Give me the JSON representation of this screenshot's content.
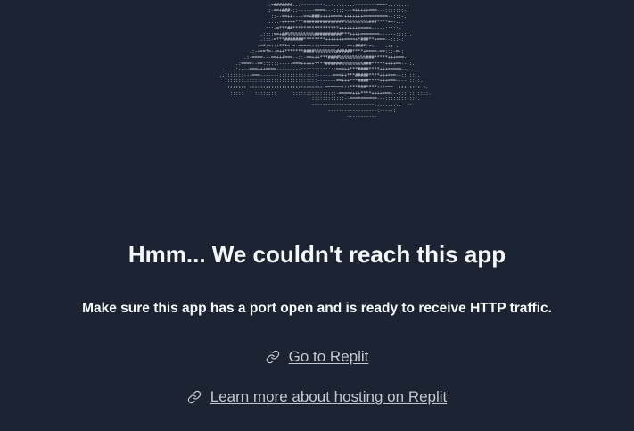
{
  "ascii_art": "                          -+##***#====--::==--::. ..   --         ::\n                        .=#######:::---------::-::::::::--------===-:.:::::.\n                        :-==+###-::------====---::::---=+++++===---:::::::-.\n                         ::--==++----==+###++++====-+++++++=========--:::-.\n                        ::::-+++++***###############%%%%%%%%%###****+=-::.\n                      .:::-=***##*****************+++++++=====-----:::::-.\n                     .::::==+##%%%%%%%%%%##########***++++=======------:::::.\n                     .:::-=***#######********+++++++====+*###**+===--:::-:\n                    :=*+=+++***=-=-====++++=======---==+###*+=:    .::-.\n                 .:-+==*=--=++*******####%%%%%%%%######****+====-==:::-=-:\n               .:-====---==+++===--::-==+++***####%%%%%%%%%%###*****+++===-.\n            .:====--==::::::-----===+++++****######%%%%%%%%###*****++++==--::.\n        .  .:----===+++====---------:::::::::::::===++***####****+++=====---.\n      ..:::::::---===-------::::::::::::::------===++***#####****+++===--::::::.\n        :::::::.::::::::::::::::::::::::::-------==+++***####****+++===----:::::.\n         :::::::-:::::::::::::::::::::::::::-======+++***###****+++===--::::::::-:.\n          :::::    ::::::::      ::::::::::::::::-=====+++****++++===---:::::::::::.\n                                        ::::::::::::--==========---::::::::::::.\n                                        -----------------------::::::::::  --\n                                              ------------------:-----:\n                                                     -----------",
  "headline": "Hmm... We couldn't reach this app",
  "subtext": "Make sure this app has a port open and is ready to receive HTTP traffic.",
  "links": {
    "go_to_replit": "Go to Replit",
    "learn_more": "Learn more about hosting on Replit"
  },
  "icons": {
    "link": "link-icon"
  },
  "colors": {
    "background": "#1c2333",
    "text": "#f5f9fc",
    "link": "#c2c8cc",
    "ascii": "#c9ced6"
  }
}
